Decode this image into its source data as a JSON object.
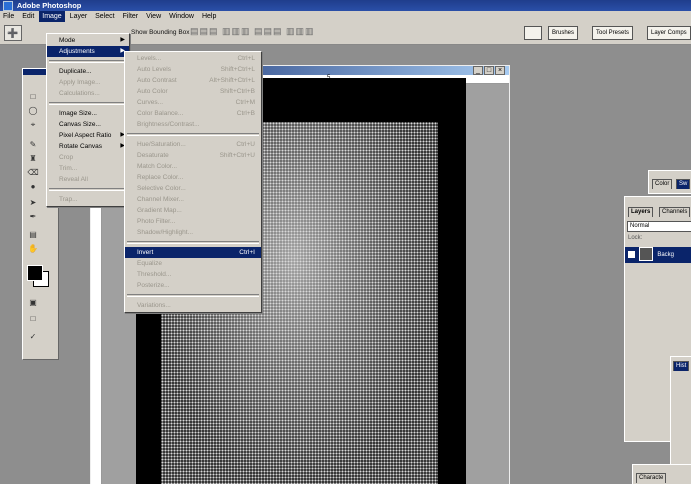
{
  "app": {
    "title": "Adobe Photoshop"
  },
  "menubar": [
    "File",
    "Edit",
    "Image",
    "Layer",
    "Select",
    "Filter",
    "View",
    "Window",
    "Help"
  ],
  "options": {
    "show_bounding_box": "Show Bounding Box",
    "tool_preset_icon": "move-tool-icon"
  },
  "palette_well": [
    "Brushes",
    "Tool Presets",
    "Layer Comps"
  ],
  "image_menu": {
    "items": [
      {
        "label": "Mode",
        "submenu": true
      },
      {
        "label": "Adjustments",
        "submenu": true,
        "highlight": true
      },
      {
        "sep": true
      },
      {
        "label": "Duplicate..."
      },
      {
        "label": "Apply Image...",
        "disabled": true
      },
      {
        "label": "Calculations...",
        "disabled": true
      },
      {
        "sep": true
      },
      {
        "label": "Image Size..."
      },
      {
        "label": "Canvas Size..."
      },
      {
        "label": "Pixel Aspect Ratio",
        "submenu": true
      },
      {
        "label": "Rotate Canvas",
        "submenu": true
      },
      {
        "label": "Crop",
        "disabled": true
      },
      {
        "label": "Trim...",
        "disabled": true
      },
      {
        "label": "Reveal All",
        "disabled": true
      },
      {
        "sep": true
      },
      {
        "label": "Trap...",
        "disabled": true
      }
    ]
  },
  "adjustments_menu": {
    "items": [
      {
        "label": "Levels...",
        "sc": "Ctrl+L",
        "disabled": true
      },
      {
        "label": "Auto Levels",
        "sc": "Shift+Ctrl+L",
        "disabled": true
      },
      {
        "label": "Auto Contrast",
        "sc": "Alt+Shift+Ctrl+L",
        "disabled": true
      },
      {
        "label": "Auto Color",
        "sc": "Shift+Ctrl+B",
        "disabled": true
      },
      {
        "label": "Curves...",
        "sc": "Ctrl+M",
        "disabled": true
      },
      {
        "label": "Color Balance...",
        "sc": "Ctrl+B",
        "disabled": true
      },
      {
        "label": "Brightness/Contrast...",
        "disabled": true
      },
      {
        "sep": true
      },
      {
        "label": "Hue/Saturation...",
        "sc": "Ctrl+U",
        "disabled": true
      },
      {
        "label": "Desaturate",
        "sc": "Shift+Ctrl+U",
        "disabled": true
      },
      {
        "label": "Match Color...",
        "disabled": true
      },
      {
        "label": "Replace Color...",
        "disabled": true
      },
      {
        "label": "Selective Color...",
        "disabled": true
      },
      {
        "label": "Channel Mixer...",
        "disabled": true
      },
      {
        "label": "Gradient Map...",
        "disabled": true
      },
      {
        "label": "Photo Filter...",
        "disabled": true
      },
      {
        "label": "Shadow/Highlight...",
        "disabled": true
      },
      {
        "sep": true
      },
      {
        "label": "Invert",
        "sc": "Ctrl+I",
        "highlight": true
      },
      {
        "label": "Equalize",
        "disabled": true
      },
      {
        "label": "Threshold...",
        "disabled": true
      },
      {
        "label": "Posterize...",
        "disabled": true
      },
      {
        "sep": true
      },
      {
        "label": "Variations...",
        "disabled": true
      }
    ]
  },
  "right_panels": {
    "color_tabs": [
      "Color",
      "Sw"
    ],
    "layers_tabs": [
      "Layers",
      "Channels"
    ],
    "blend_mode": "Normal",
    "lock_label": "Lock:",
    "layer_name": "Backg",
    "history_tab": "Hist",
    "character_tab": "Characte"
  },
  "doc": {
    "ruler_mark": "5"
  }
}
